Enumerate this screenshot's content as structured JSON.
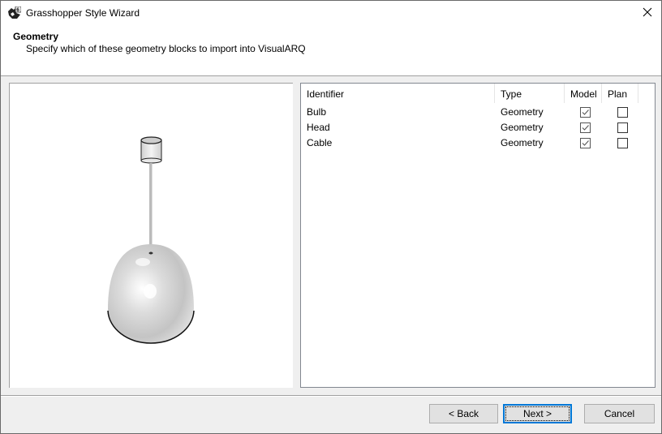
{
  "window": {
    "title": "Grasshopper Style Wizard",
    "icon": "rhino-grasshopper-app-icon",
    "close_icon": "close-icon"
  },
  "header": {
    "title": "Geometry",
    "subtitle": "Specify which of these geometry blocks to import into VisualARQ"
  },
  "preview": {
    "description": "3D preview of pendant lamp: ceiling cup, cable, dome head"
  },
  "table": {
    "columns": [
      "Identifier",
      "Type",
      "Model",
      "Plan"
    ],
    "rows": [
      {
        "identifier": "Bulb",
        "type": "Geometry",
        "model": true,
        "plan": false
      },
      {
        "identifier": "Head",
        "type": "Geometry",
        "model": true,
        "plan": false
      },
      {
        "identifier": "Cable",
        "type": "Geometry",
        "model": true,
        "plan": false
      }
    ]
  },
  "buttons": {
    "back": "< Back",
    "next": "Next >",
    "cancel": "Cancel"
  }
}
